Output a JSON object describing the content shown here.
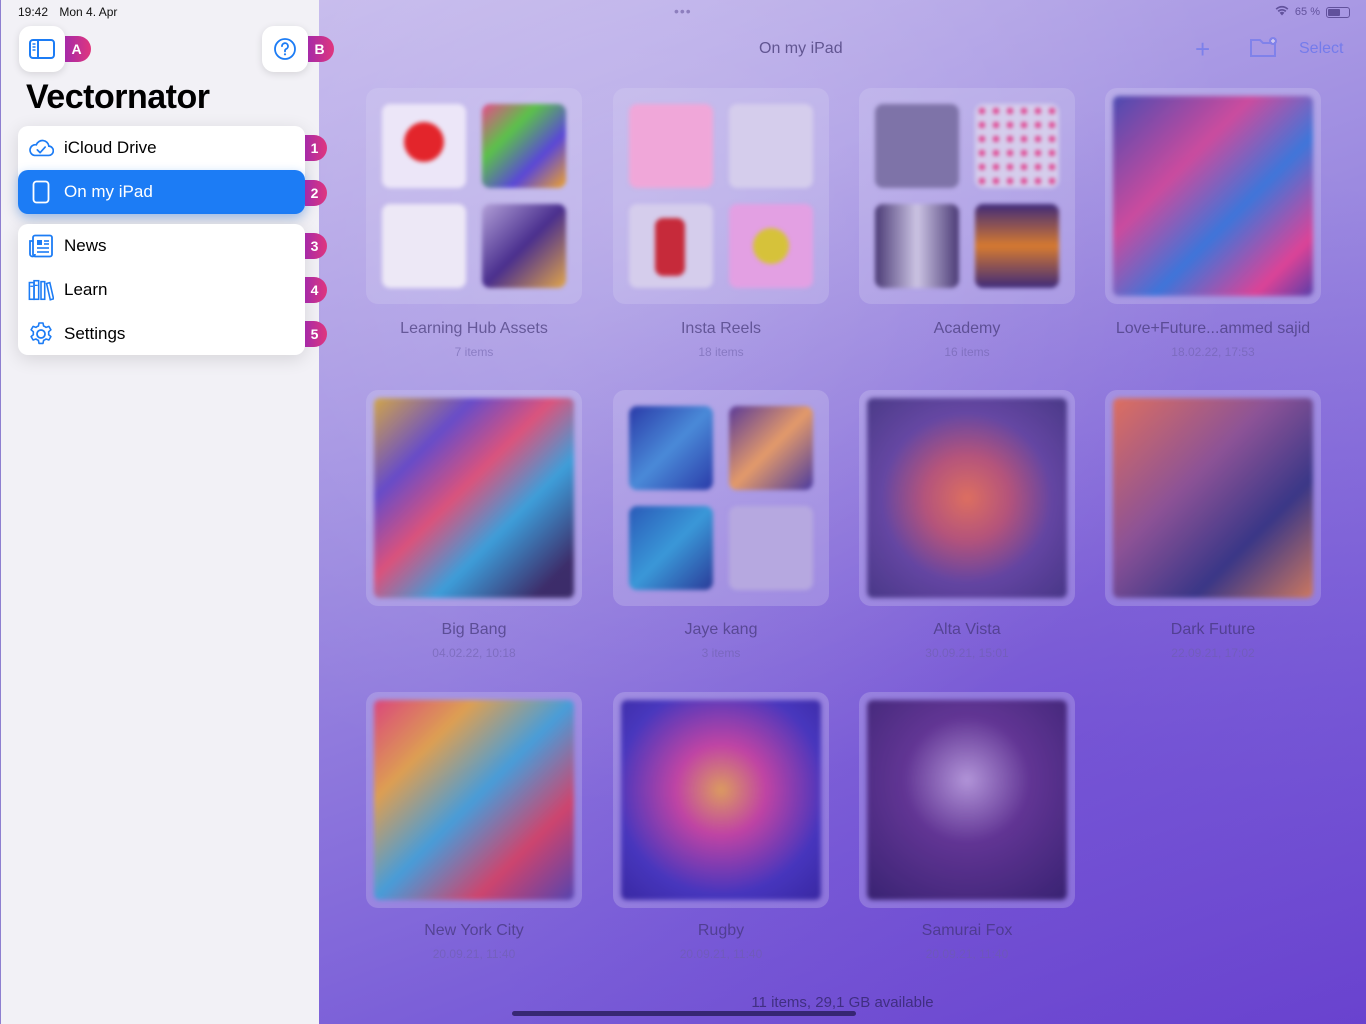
{
  "status_bar": {
    "time": "19:42",
    "date": "Mon 4. Apr",
    "battery": "65 %",
    "battery_level": 0.65
  },
  "sidebar": {
    "app_title": "Vectornator",
    "toggle_badge": "A",
    "help_badge": "B",
    "locations": [
      {
        "label": "iCloud Drive",
        "badge": "1",
        "icon": "cloud-check-icon"
      },
      {
        "label": "On my iPad",
        "badge": "2",
        "icon": "ipad-icon",
        "selected": true
      }
    ],
    "menu": [
      {
        "label": "News",
        "badge": "3",
        "icon": "newspaper-icon"
      },
      {
        "label": "Learn",
        "badge": "4",
        "icon": "books-icon"
      },
      {
        "label": "Settings",
        "badge": "5",
        "icon": "gear-icon"
      }
    ]
  },
  "main": {
    "nav_title": "On my iPad",
    "select_label": "Select",
    "footer": "11 items, 29,1 GB available",
    "documents": [
      {
        "name": "Learning Hub Assets",
        "meta": "7 items",
        "kind": "folder"
      },
      {
        "name": "Insta Reels",
        "meta": "18 items",
        "kind": "folder"
      },
      {
        "name": "Academy",
        "meta": "16 items",
        "kind": "folder"
      },
      {
        "name": "Love+Future...ammed sajid",
        "meta": "18.02.22, 17:53",
        "kind": "file"
      },
      {
        "name": "Big Bang",
        "meta": "04.02.22, 10:18",
        "kind": "file"
      },
      {
        "name": "Jaye kang",
        "meta": "3 items",
        "kind": "folder"
      },
      {
        "name": "Alta Vista",
        "meta": "30.09.21, 15:01",
        "kind": "file"
      },
      {
        "name": "Dark Future",
        "meta": "22.09.21, 17:02",
        "kind": "file"
      },
      {
        "name": "New York City",
        "meta": "20.09.21, 11:40",
        "kind": "file"
      },
      {
        "name": "Rugby",
        "meta": "20.09.21, 11:40",
        "kind": "file"
      },
      {
        "name": "Samurai Fox",
        "meta": "20.09.21, 11:40",
        "kind": "file"
      }
    ]
  },
  "colors": {
    "accent": "#1c7cf5",
    "badge_gradient_start": "#a62aa8",
    "badge_gradient_end": "#e0367d"
  }
}
